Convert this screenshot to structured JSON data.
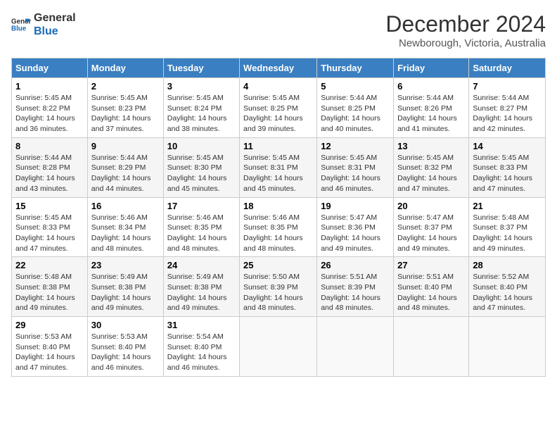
{
  "logo": {
    "text_general": "General",
    "text_blue": "Blue"
  },
  "header": {
    "month": "December 2024",
    "location": "Newborough, Victoria, Australia"
  },
  "days_of_week": [
    "Sunday",
    "Monday",
    "Tuesday",
    "Wednesday",
    "Thursday",
    "Friday",
    "Saturday"
  ],
  "weeks": [
    [
      {
        "day": "1",
        "sunrise": "5:45 AM",
        "sunset": "8:22 PM",
        "daylight": "14 hours and 36 minutes."
      },
      {
        "day": "2",
        "sunrise": "5:45 AM",
        "sunset": "8:23 PM",
        "daylight": "14 hours and 37 minutes."
      },
      {
        "day": "3",
        "sunrise": "5:45 AM",
        "sunset": "8:24 PM",
        "daylight": "14 hours and 38 minutes."
      },
      {
        "day": "4",
        "sunrise": "5:45 AM",
        "sunset": "8:25 PM",
        "daylight": "14 hours and 39 minutes."
      },
      {
        "day": "5",
        "sunrise": "5:44 AM",
        "sunset": "8:25 PM",
        "daylight": "14 hours and 40 minutes."
      },
      {
        "day": "6",
        "sunrise": "5:44 AM",
        "sunset": "8:26 PM",
        "daylight": "14 hours and 41 minutes."
      },
      {
        "day": "7",
        "sunrise": "5:44 AM",
        "sunset": "8:27 PM",
        "daylight": "14 hours and 42 minutes."
      }
    ],
    [
      {
        "day": "8",
        "sunrise": "5:44 AM",
        "sunset": "8:28 PM",
        "daylight": "14 hours and 43 minutes."
      },
      {
        "day": "9",
        "sunrise": "5:44 AM",
        "sunset": "8:29 PM",
        "daylight": "14 hours and 44 minutes."
      },
      {
        "day": "10",
        "sunrise": "5:45 AM",
        "sunset": "8:30 PM",
        "daylight": "14 hours and 45 minutes."
      },
      {
        "day": "11",
        "sunrise": "5:45 AM",
        "sunset": "8:31 PM",
        "daylight": "14 hours and 45 minutes."
      },
      {
        "day": "12",
        "sunrise": "5:45 AM",
        "sunset": "8:31 PM",
        "daylight": "14 hours and 46 minutes."
      },
      {
        "day": "13",
        "sunrise": "5:45 AM",
        "sunset": "8:32 PM",
        "daylight": "14 hours and 47 minutes."
      },
      {
        "day": "14",
        "sunrise": "5:45 AM",
        "sunset": "8:33 PM",
        "daylight": "14 hours and 47 minutes."
      }
    ],
    [
      {
        "day": "15",
        "sunrise": "5:45 AM",
        "sunset": "8:33 PM",
        "daylight": "14 hours and 47 minutes."
      },
      {
        "day": "16",
        "sunrise": "5:46 AM",
        "sunset": "8:34 PM",
        "daylight": "14 hours and 48 minutes."
      },
      {
        "day": "17",
        "sunrise": "5:46 AM",
        "sunset": "8:35 PM",
        "daylight": "14 hours and 48 minutes."
      },
      {
        "day": "18",
        "sunrise": "5:46 AM",
        "sunset": "8:35 PM",
        "daylight": "14 hours and 48 minutes."
      },
      {
        "day": "19",
        "sunrise": "5:47 AM",
        "sunset": "8:36 PM",
        "daylight": "14 hours and 49 minutes."
      },
      {
        "day": "20",
        "sunrise": "5:47 AM",
        "sunset": "8:37 PM",
        "daylight": "14 hours and 49 minutes."
      },
      {
        "day": "21",
        "sunrise": "5:48 AM",
        "sunset": "8:37 PM",
        "daylight": "14 hours and 49 minutes."
      }
    ],
    [
      {
        "day": "22",
        "sunrise": "5:48 AM",
        "sunset": "8:38 PM",
        "daylight": "14 hours and 49 minutes."
      },
      {
        "day": "23",
        "sunrise": "5:49 AM",
        "sunset": "8:38 PM",
        "daylight": "14 hours and 49 minutes."
      },
      {
        "day": "24",
        "sunrise": "5:49 AM",
        "sunset": "8:38 PM",
        "daylight": "14 hours and 49 minutes."
      },
      {
        "day": "25",
        "sunrise": "5:50 AM",
        "sunset": "8:39 PM",
        "daylight": "14 hours and 48 minutes."
      },
      {
        "day": "26",
        "sunrise": "5:51 AM",
        "sunset": "8:39 PM",
        "daylight": "14 hours and 48 minutes."
      },
      {
        "day": "27",
        "sunrise": "5:51 AM",
        "sunset": "8:40 PM",
        "daylight": "14 hours and 48 minutes."
      },
      {
        "day": "28",
        "sunrise": "5:52 AM",
        "sunset": "8:40 PM",
        "daylight": "14 hours and 47 minutes."
      }
    ],
    [
      {
        "day": "29",
        "sunrise": "5:53 AM",
        "sunset": "8:40 PM",
        "daylight": "14 hours and 47 minutes."
      },
      {
        "day": "30",
        "sunrise": "5:53 AM",
        "sunset": "8:40 PM",
        "daylight": "14 hours and 46 minutes."
      },
      {
        "day": "31",
        "sunrise": "5:54 AM",
        "sunset": "8:40 PM",
        "daylight": "14 hours and 46 minutes."
      },
      null,
      null,
      null,
      null
    ]
  ],
  "labels": {
    "sunrise": "Sunrise:",
    "sunset": "Sunset:",
    "daylight": "Daylight:"
  }
}
